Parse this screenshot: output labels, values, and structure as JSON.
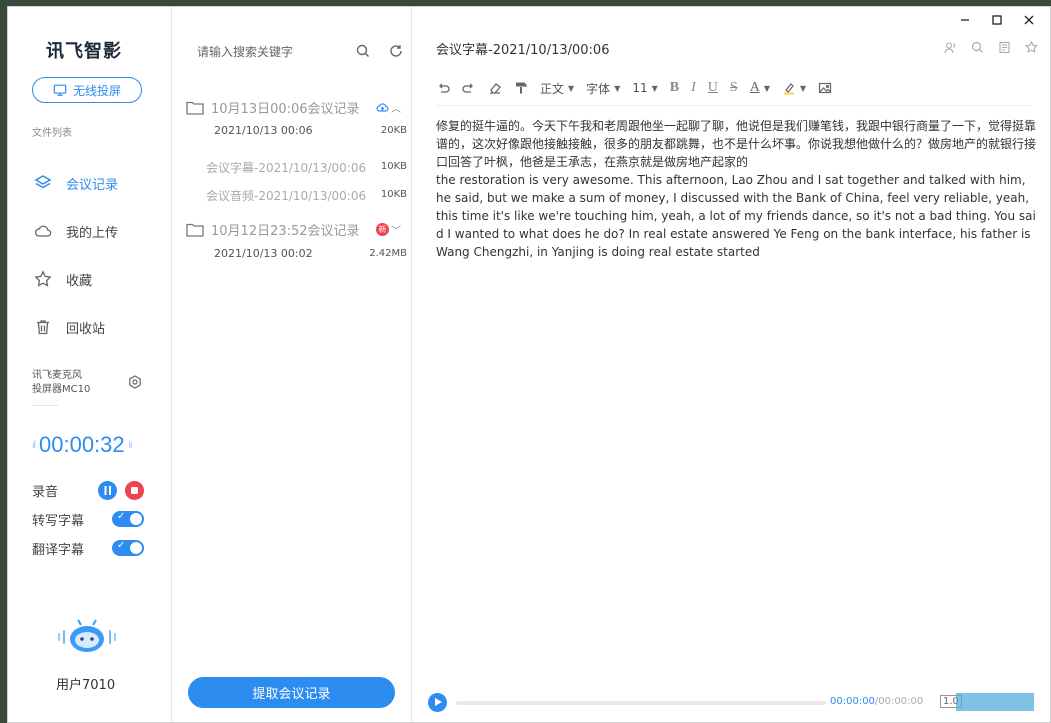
{
  "sidebar": {
    "logo": "讯飞智影",
    "cast_button": "无线投屏",
    "section_label": "文件列表",
    "nav": [
      {
        "label": "会议记录",
        "icon": "layers-icon",
        "active": true
      },
      {
        "label": "我的上传",
        "icon": "cloud-icon",
        "active": false
      },
      {
        "label": "收藏",
        "icon": "star-icon",
        "active": false
      },
      {
        "label": "回收站",
        "icon": "trash-icon",
        "active": false
      }
    ],
    "device_line1": "讯飞麦克风",
    "device_line2": "投屏器MC10",
    "timer": "00:00:32",
    "record_label": "录音",
    "transcribe_label": "转写字幕",
    "translate_label": "翻译字幕",
    "username": "用户7010"
  },
  "filelist": {
    "search_placeholder": "请输入搜索关键字",
    "folders": [
      {
        "name": "10月13日00:06会议记录",
        "date": "2021/10/13 00:06",
        "size": "20KB",
        "badge": "cloud-upload-icon",
        "expanded": true,
        "files": [
          {
            "name": "会议字幕-2021/10/13/00:06",
            "size": "10KB"
          },
          {
            "name": "会议音频-2021/10/13/00:06",
            "size": "10KB"
          }
        ]
      },
      {
        "name": "10月12日23:52会议记录",
        "date": "2021/10/13 00:02",
        "size": "2.42MB",
        "badge": "new-badge-icon",
        "badge_text": "新",
        "expanded": false,
        "files": []
      }
    ],
    "extract_button": "提取会议记录"
  },
  "editor": {
    "title": "会议字幕-2021/10/13/00:06",
    "toolbar": {
      "paragraph": "正文",
      "font": "字体",
      "size": "11",
      "bold": "B",
      "italic": "I",
      "underline": "U",
      "strike": "S",
      "font_color": "A"
    },
    "paragraphs": [
      "修复的挺牛逼的。今天下午我和老周跟他坐一起聊了聊，他说但是我们赚笔钱，我跟中银行商量了一下，觉得挺靠谱的，这次好像跟他接触接触，很多的朋友都跳舞，也不是什么坏事。你说我想他做什么的？做房地产的就银行接口回答了叶枫，他爸是王承志，在燕京就是做房地产起家的",
      " the restoration is very awesome. This afternoon, Lao Zhou and I sat together and talked with him, he said, but we make a sum of money, I discussed with the Bank of China, feel very reliable, yeah, this time it's like we're touching him, yeah, a lot of my friends dance, so it's not a bad thing. You said I wanted to what does he do? In real estate answered Ye Feng on the bank interface, his father is Wang Chengzhi, in Yanjing is doing real estate started"
    ],
    "player": {
      "current": "00:00:00",
      "total": "/00:00:00",
      "speed": "1.0",
      "progress": 0.0
    }
  },
  "colors": {
    "accent": "#2d8cf0",
    "stop": "#f0424f"
  }
}
